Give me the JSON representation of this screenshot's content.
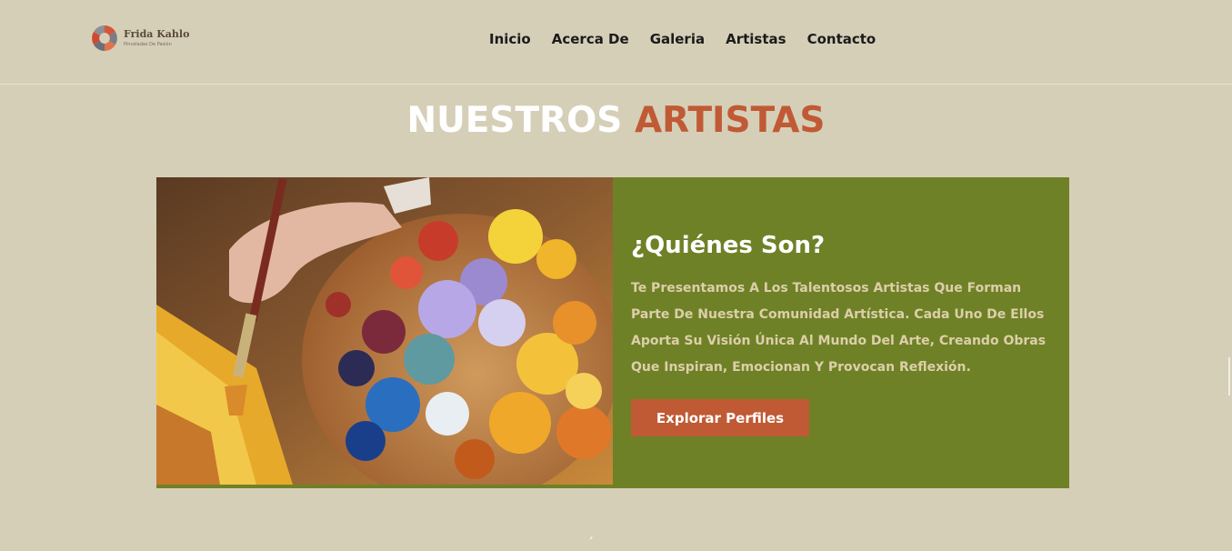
{
  "brand": {
    "name": "Frida Kahlo",
    "tagline": "Pinceladas De Pasión"
  },
  "nav": {
    "items": [
      {
        "label": "Inicio"
      },
      {
        "label": "Acerca De"
      },
      {
        "label": "Galeria"
      },
      {
        "label": "Artistas"
      },
      {
        "label": "Contacto"
      }
    ]
  },
  "hero": {
    "title_part1": "NUESTROS",
    "title_part2": "ARTISTAS"
  },
  "card": {
    "heading": "¿Quiénes Son?",
    "body": "Te Presentamos A Los Talentosos Artistas Que Forman Parte De Nuestra Comunidad Artística. Cada Uno De Ellos Aporta Su Visión Única Al Mundo Del Arte, Creando Obras Que Inspiran, Emocionan Y Provocan Reflexión.",
    "button_label": "Explorar Perfiles",
    "image_icon": "paint-palette-image"
  },
  "colors": {
    "background": "#d6cfb8",
    "accent": "#c05a35",
    "card": "#6f8127",
    "card_text": "#dccfa9"
  },
  "footer_glyph": "´"
}
